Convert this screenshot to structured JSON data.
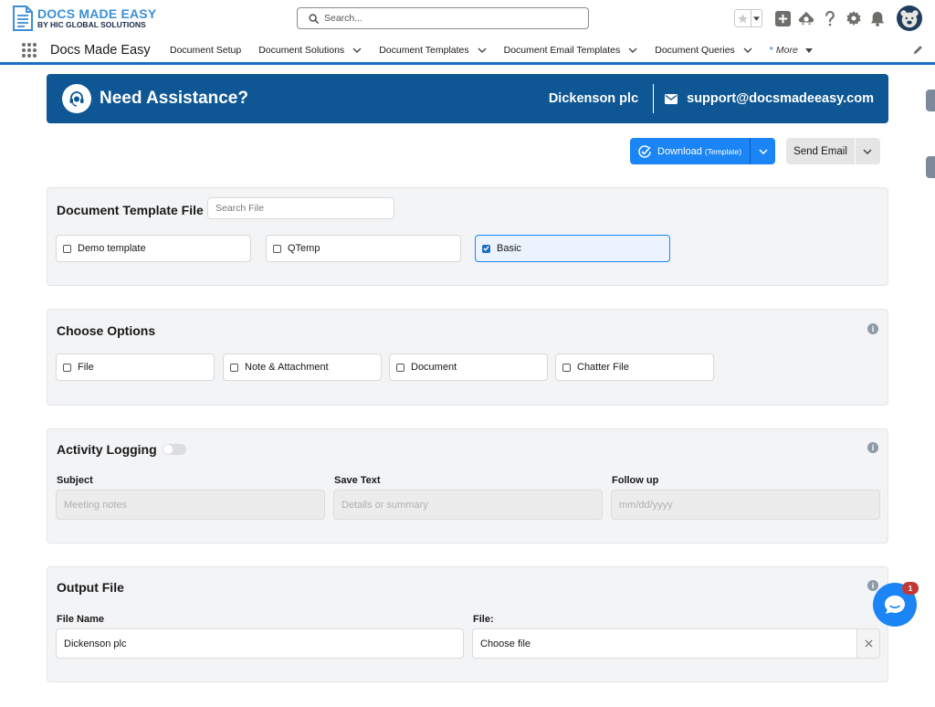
{
  "header": {
    "logo_main": "DOCS MADE EASY",
    "logo_sub": "BY HIC GLOBAL SOLUTIONS",
    "search_placeholder": "Search...",
    "icons": [
      "star-icon",
      "chevron-down-icon",
      "add-icon",
      "trailhead-icon",
      "help-icon",
      "gear-icon",
      "bell-icon",
      "avatar"
    ]
  },
  "nav": {
    "app_name": "Docs Made Easy",
    "items": [
      {
        "label": "Document Setup",
        "has_dropdown": false
      },
      {
        "label": "Document Solutions",
        "has_dropdown": true
      },
      {
        "label": "Document Templates",
        "has_dropdown": true
      },
      {
        "label": "Document Email Templates",
        "has_dropdown": true
      },
      {
        "label": "Document Queries",
        "has_dropdown": true
      }
    ],
    "more_marker": "*",
    "more_label": "More"
  },
  "banner": {
    "title": "Need Assistance?",
    "company": "Dickenson plc",
    "email": "support@docsmadeeasy.com"
  },
  "actions": {
    "download_label": "Download",
    "download_sub": "(Template)",
    "send_email_label": "Send Email"
  },
  "template_file": {
    "title": "Document Template File",
    "search_placeholder": "Search File",
    "options": [
      {
        "label": "Demo template",
        "checked": false
      },
      {
        "label": "QTemp",
        "checked": false
      },
      {
        "label": "Basic",
        "checked": true
      }
    ]
  },
  "choose_options": {
    "title": "Choose Options",
    "options": [
      {
        "label": "File",
        "checked": false
      },
      {
        "label": "Note & Attachment",
        "checked": false
      },
      {
        "label": "Document",
        "checked": false
      },
      {
        "label": "Chatter File",
        "checked": false
      }
    ]
  },
  "activity_logging": {
    "title": "Activity Logging",
    "enabled": false,
    "subject_label": "Subject",
    "subject_placeholder": "Meeting notes",
    "save_text_label": "Save Text",
    "save_text_placeholder": "Details or summary",
    "follow_up_label": "Follow up",
    "follow_up_placeholder": "mm/dd/yyyy"
  },
  "output_file": {
    "title": "Output File",
    "file_name_label": "File Name",
    "file_name_value": "Dickenson plc",
    "file_label": "File:",
    "file_button": "Choose file"
  },
  "chat": {
    "badge_count": "1"
  },
  "colors": {
    "banner": "#0f5794",
    "brand_blue": "#1b85f5",
    "nav_underline": "#1b6fc2",
    "card_bg": "#f3f4f6"
  }
}
